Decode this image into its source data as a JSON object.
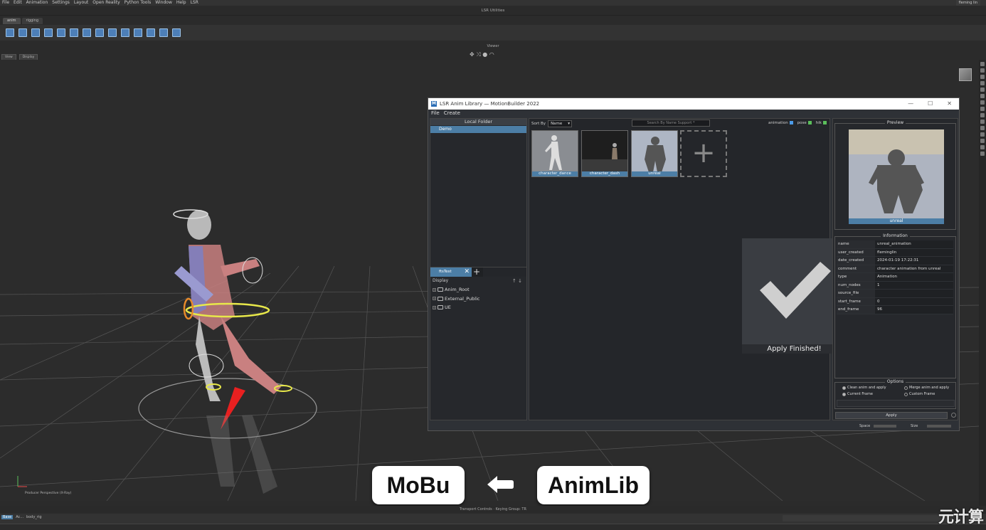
{
  "menubar": {
    "items": [
      "File",
      "Edit",
      "Animation",
      "Settings",
      "Layout",
      "Open Reality",
      "Python Tools",
      "Window",
      "Help",
      "LSR"
    ],
    "user": "fleming lin"
  },
  "utilities_title": "LSR Utilities",
  "top_tabs": [
    "anim",
    "rigging"
  ],
  "viewer": {
    "title": "Viewer",
    "view_buttons": [
      "View",
      "Display"
    ],
    "perspective_label": "Producer Perspective (X-Ray)"
  },
  "overlay": {
    "left_label": "MoBu",
    "right_label": "AnimLib",
    "arrow_icon": "arrow-left-icon"
  },
  "animlib": {
    "title": "LSR Anim Library  —  MotionBuilder 2022",
    "menu": [
      "File",
      "Create"
    ],
    "local_folder_title": "Local Folder",
    "local_item": "Demo",
    "filter_tab": "ftsTest",
    "display_label": "Display",
    "tree": [
      "Anim_Root",
      "External_Public",
      "UE"
    ],
    "sort_by_label": "Sort By",
    "sort_value": "Name",
    "search_placeholder": "Search By Name  Support *",
    "filters": [
      {
        "label": "animation",
        "color": "#4c9be8"
      },
      {
        "label": "pose",
        "color": "#5bbf5b"
      },
      {
        "label": "hik",
        "color": "#5bbf5b"
      }
    ],
    "thumbnails": [
      "character_dance",
      "character_dash",
      "unreal"
    ],
    "apply_message": "Apply Finished!",
    "preview_title": "Preview",
    "preview_label": "unreal",
    "info_title": "Information",
    "info": [
      {
        "key": "name",
        "value": "unreal_animation"
      },
      {
        "key": "user_created",
        "value": "fleminglin"
      },
      {
        "key": "date_created",
        "value": "2024-01-19 17:22:31"
      },
      {
        "key": "comment",
        "value": "character animation from unreal"
      },
      {
        "key": "type",
        "value": "Animation"
      },
      {
        "key": "num_nodes",
        "value": "1"
      },
      {
        "key": "source_file",
        "value": ""
      },
      {
        "key": "start_frame",
        "value": "0"
      },
      {
        "key": "end_frame",
        "value": "96"
      }
    ],
    "options_title": "Options",
    "options": {
      "clean": "Clean anim and apply",
      "merge": "Merge anim and apply",
      "current": "Current Frame",
      "custom": "Custom Frame"
    },
    "apply_button": "Apply",
    "space_label": "Space",
    "size_label": "Size"
  },
  "bottom": {
    "transport_title": "Transport Controls  ·  Keying Group: TR",
    "left_items": [
      "Base",
      "Ac...",
      "body_rig"
    ]
  },
  "watermark": "元计算"
}
